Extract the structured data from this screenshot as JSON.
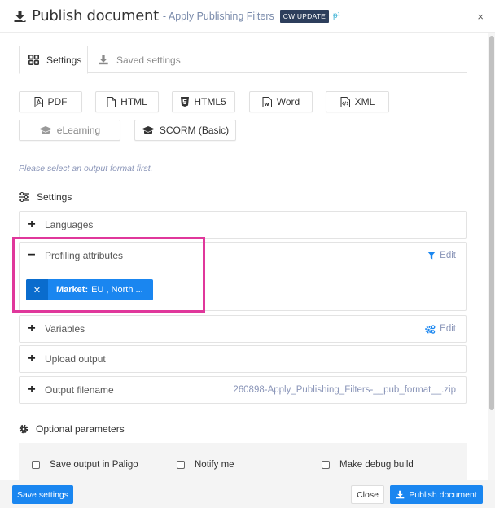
{
  "header": {
    "title": "Publish document",
    "subtitle": "- Apply Publishing Filters",
    "badge": "CW UPDATE",
    "version": "ᵽ¹",
    "close_label": "×"
  },
  "tabs": [
    {
      "label": "Settings",
      "icon": "grid-icon",
      "active": true
    },
    {
      "label": "Saved settings",
      "icon": "download-icon",
      "active": false
    }
  ],
  "formats": [
    {
      "label": "PDF",
      "icon": "file-pdf-icon",
      "enabled": true
    },
    {
      "label": "HTML",
      "icon": "file-icon",
      "enabled": true
    },
    {
      "label": "HTML5",
      "icon": "html5-icon",
      "enabled": true
    },
    {
      "label": "Word",
      "icon": "file-word-icon",
      "enabled": true
    },
    {
      "label": "XML",
      "icon": "file-code-icon",
      "enabled": true
    },
    {
      "label": "eLearning",
      "icon": "graduation-cap-icon",
      "enabled": false
    },
    {
      "label": "SCORM (Basic)",
      "icon": "graduation-cap-icon",
      "enabled": true
    }
  ],
  "hint": "Please select an output format first.",
  "settings_section": {
    "title": "Settings",
    "panels": [
      {
        "label": "Languages",
        "expanded": false,
        "right": ""
      },
      {
        "label": "Profiling attributes",
        "expanded": true,
        "right": "Edit",
        "right_icon": "filter-icon",
        "tags": [
          {
            "key": "Market:",
            "value": "EU , North ..."
          }
        ]
      },
      {
        "label": "Variables",
        "expanded": false,
        "right": "Edit",
        "right_icon": "gears-icon"
      },
      {
        "label": "Upload output",
        "expanded": false,
        "right": ""
      },
      {
        "label": "Output filename",
        "expanded": false,
        "right": "260898-Apply_Publishing_Filters-__pub_format__.zip"
      }
    ]
  },
  "optional_section": {
    "title": "Optional parameters",
    "checkboxes": [
      {
        "label": "Save output in Paligo",
        "checked": false
      },
      {
        "label": "Notify me",
        "checked": false
      },
      {
        "label": "Make debug build",
        "checked": false
      }
    ]
  },
  "footer": {
    "save_settings": "Save settings",
    "close": "Close",
    "publish": "Publish document"
  },
  "colors": {
    "primary": "#1a86f0",
    "badge": "#2d3e5c",
    "highlight": "#e0379b"
  }
}
